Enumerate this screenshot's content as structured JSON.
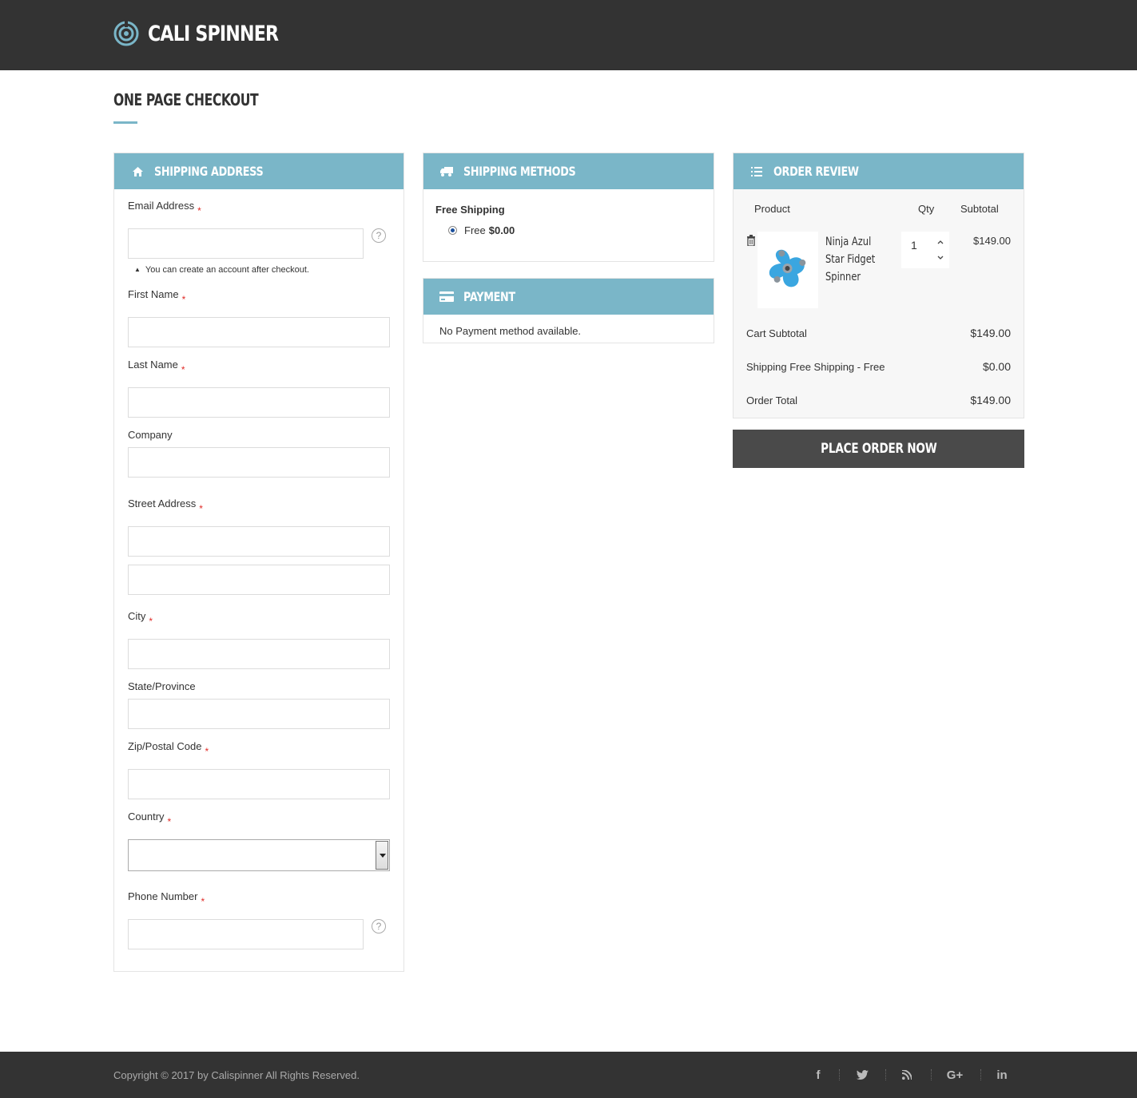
{
  "header": {
    "brand": "CALI SPINNER",
    "logo_icon": "spinner-logo-icon"
  },
  "page": {
    "title": "ONE PAGE CHECKOUT"
  },
  "colors": {
    "header_bg": "#333333",
    "accent": "#7ab6c8",
    "button_bg": "#4a4a4a",
    "required": "#e02b27"
  },
  "shipping_address": {
    "title": "SHIPPING ADDRESS",
    "icon": "home-icon",
    "email_label": "Email Address",
    "account_note": "You can create an account after checkout.",
    "first_name_label": "First Name",
    "last_name_label": "Last Name",
    "company_label": "Company",
    "street_label": "Street Address",
    "city_label": "City",
    "state_label": "State/Province",
    "zip_label": "Zip/Postal Code",
    "country_label": "Country",
    "phone_label": "Phone Number",
    "required_mark": "*",
    "help_mark": "?"
  },
  "shipping_methods": {
    "title": "SHIPPING METHODS",
    "icon": "truck-icon",
    "carrier": "Free Shipping",
    "option_label": "Free",
    "option_price": "$0.00"
  },
  "payment": {
    "title": "PAYMENT",
    "icon": "credit-card-icon",
    "message": "No Payment method available."
  },
  "order_review": {
    "title": "ORDER REVIEW",
    "icon": "list-icon",
    "columns": {
      "product": "Product",
      "qty": "Qty",
      "subtotal": "Subtotal"
    },
    "item": {
      "name": "Ninja Azul Star Fidget Spinner",
      "qty": "1",
      "subtotal": "$149.00"
    },
    "totals": {
      "cart_subtotal_label": "Cart Subtotal",
      "cart_subtotal_value": "$149.00",
      "shipping_label": "Shipping Free Shipping - Free",
      "shipping_value": "$0.00",
      "order_total_label": "Order Total",
      "order_total_value": "$149.00"
    },
    "place_order_label": "PLACE ORDER NOW"
  },
  "footer": {
    "copyright": "Copyright © 2017 by Calispinner All Rights Reserved.",
    "social": [
      "facebook-icon",
      "twitter-icon",
      "rss-icon",
      "google-plus-icon",
      "linkedin-icon"
    ],
    "google_plus_text": "G+",
    "linkedin_text": "in",
    "facebook_text": "f"
  }
}
